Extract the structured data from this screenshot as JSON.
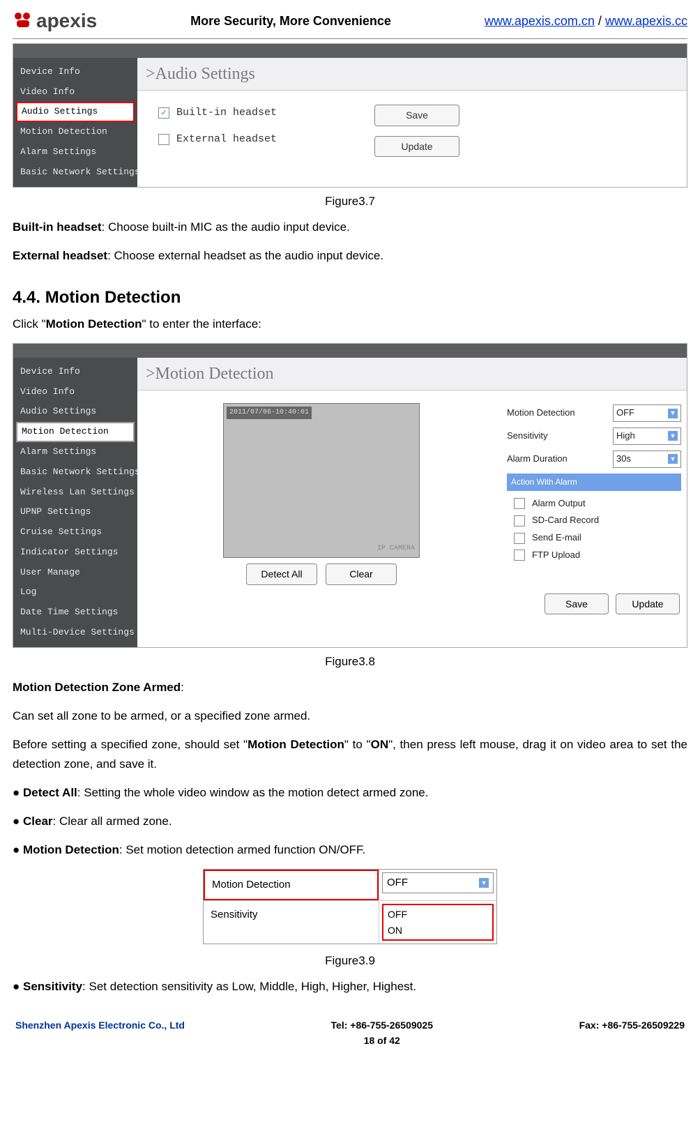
{
  "header": {
    "brand": "apexis",
    "tagline": "More Security, More Convenience",
    "link1": "www.apexis.com.cn",
    "sep": " / ",
    "link2": "www.apexis.cc"
  },
  "fig37": {
    "nav": [
      "Device Info",
      "Video Info",
      "Audio Settings",
      "Motion Detection",
      "Alarm Settings",
      "Basic Network Settings"
    ],
    "title": ">Audio Settings",
    "chk1": "Built-in headset",
    "chk2": "External headset",
    "btn1": "Save",
    "btn2": "Update"
  },
  "cap37": "Figure3.7",
  "p1a": "Built-in headset",
  "p1b": ": Choose built-in MIC as the audio input device.",
  "p2a": "External headset",
  "p2b": ": Choose external headset as the audio input device.",
  "h44": "4.4. Motion Detection",
  "p3pre": "Click \"",
  "p3b": "Motion Detection",
  "p3suf": "\" to enter the interface:",
  "fig38": {
    "nav": [
      "Device Info",
      "Video Info",
      "Audio Settings",
      "Motion Detection",
      "Alarm Settings",
      "Basic Network Settings",
      "Wireless Lan Settings",
      "UPNP Settings",
      "Cruise Settings",
      "Indicator Settings",
      "User Manage",
      "Log",
      "Date Time Settings",
      "Multi-Device Settings"
    ],
    "title": ">Motion Detection",
    "ts": "2011/07/06-10:40:01",
    "wm": "IP CAMERA",
    "vb1": "Detect All",
    "vb2": "Clear",
    "r1l": "Motion Detection",
    "r1v": "OFF",
    "r2l": "Sensitivity",
    "r2v": "High",
    "r3l": "Alarm Duration",
    "r3v": "30s",
    "ahdr": "Action With Alarm",
    "a1": "Alarm Output",
    "a2": "SD-Card Record",
    "a3": "Send E-mail",
    "a4": "FTP Upload",
    "b1": "Save",
    "b2": "Update"
  },
  "cap38": "Figure3.8",
  "mz": "Motion Detection Zone Armed",
  "p4": "Can set all zone to be armed, or a specified zone armed.",
  "p5a": "Before setting a specified zone, should set \"",
  "p5b": "Motion Detection",
  "p5c": "\" to \"",
  "p5d": "ON",
  "p5e": "\", then press left mouse, drag it on video area to set the detection zone, and save it.",
  "b1a": "● ",
  "b1b": "Detect All",
  "b1c": ": Setting the whole video window as the motion detect armed zone.",
  "b2a": "● ",
  "b2b": "Clear",
  "b2c": ": Clear all armed zone.",
  "b3a": "● ",
  "b3b": "Motion Detection",
  "b3c": ": Set motion detection armed function ON/OFF.",
  "fig39": {
    "l1": "Motion Detection",
    "v1": "OFF",
    "l2": "Sensitivity",
    "o1": "OFF",
    "o2": "ON"
  },
  "cap39": "Figure3.9",
  "b4a": "● ",
  "b4b": "Sensitivity",
  "b4c": ": Set detection sensitivity as Low, Middle, High, Higher, Highest.",
  "footer": {
    "l": "Shenzhen Apexis Electronic Co., Ltd",
    "m1": "Tel: +86-755-26509025",
    "m2": "18 of 42",
    "r": "Fax: +86-755-26509229"
  }
}
